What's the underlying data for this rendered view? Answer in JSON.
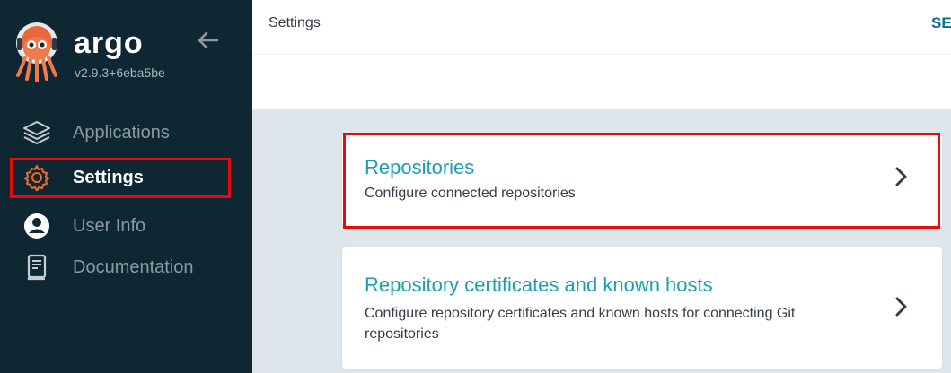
{
  "app": {
    "brand": "argo",
    "version": "v2.9.3+6eba5be"
  },
  "sidebar": {
    "items": [
      {
        "label": "Applications",
        "icon": "layers-icon",
        "active": false
      },
      {
        "label": "Settings",
        "icon": "gear-icon",
        "active": true
      },
      {
        "label": "User Info",
        "icon": "user-circle-icon",
        "active": false
      },
      {
        "label": "Documentation",
        "icon": "book-icon",
        "active": false
      }
    ]
  },
  "topbar": {
    "title": "Settings",
    "right_link": "SE"
  },
  "cards": [
    {
      "title": "Repositories",
      "description": "Configure connected repositories"
    },
    {
      "title": "Repository certificates and known hosts",
      "description": "Configure repository certificates and known hosts for connecting Git repositories"
    }
  ],
  "colors": {
    "sidebar_bg": "#0e2733",
    "accent": "#1a9fb3",
    "highlight": "#e60a0a",
    "active_icon": "#e96d31"
  }
}
